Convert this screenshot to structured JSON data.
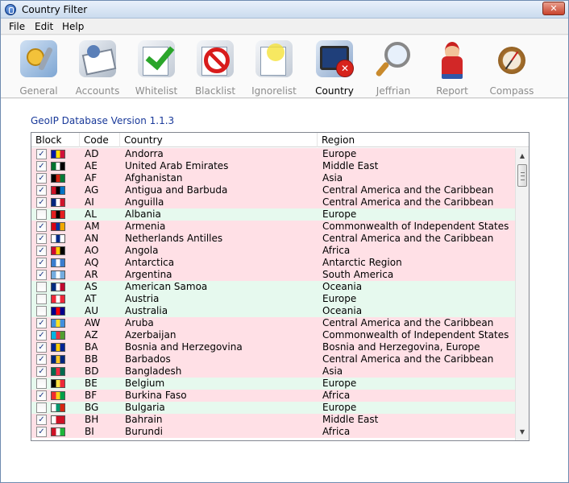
{
  "window": {
    "title": "Country Filter",
    "close_glyph": "✕"
  },
  "menu": [
    {
      "label": "File"
    },
    {
      "label": "Edit"
    },
    {
      "label": "Help"
    }
  ],
  "toolbar": [
    {
      "label": "General",
      "icon": "gear-key-icon",
      "active": false
    },
    {
      "label": "Accounts",
      "icon": "accounts-icon",
      "active": false
    },
    {
      "label": "Whitelist",
      "icon": "whitelist-check-icon",
      "active": false
    },
    {
      "label": "Blacklist",
      "icon": "blacklist-forbidden-icon",
      "active": false
    },
    {
      "label": "Ignorelist",
      "icon": "ignorelist-icon",
      "active": false
    },
    {
      "label": "Country",
      "icon": "country-block-icon",
      "active": true
    },
    {
      "label": "Jeffrian",
      "icon": "magnifier-icon",
      "active": false
    },
    {
      "label": "Report",
      "icon": "report-agent-icon",
      "active": false
    },
    {
      "label": "Compass",
      "icon": "compass-icon",
      "active": false
    }
  ],
  "geoip": {
    "version_label": "GeoIP Database Version 1.1.3"
  },
  "table": {
    "columns": [
      "Block",
      "Code",
      "Country",
      "Region"
    ],
    "colors": {
      "blocked_row": "#ffe0e6",
      "allowed_row": "#e6f9ee",
      "checkmark": "#1f3a8a"
    },
    "rows": [
      {
        "block": true,
        "code": "AD",
        "country": "Andorra",
        "region": "Europe",
        "flag": [
          "#0018a8",
          "#fedf00",
          "#d0103a"
        ]
      },
      {
        "block": true,
        "code": "AE",
        "country": "United Arab Emirates",
        "region": "Middle East",
        "flag": [
          "#00732f",
          "#ffffff",
          "#000000"
        ]
      },
      {
        "block": true,
        "code": "AF",
        "country": "Afghanistan",
        "region": "Asia",
        "flag": [
          "#000000",
          "#d32011",
          "#007a36"
        ]
      },
      {
        "block": true,
        "code": "AG",
        "country": "Antigua and Barbuda",
        "region": "Central America and the Caribbean",
        "flag": [
          "#ce1126",
          "#000000",
          "#0072c6"
        ]
      },
      {
        "block": true,
        "code": "AI",
        "country": "Anguilla",
        "region": "Central America and the Caribbean",
        "flag": [
          "#00247d",
          "#ffffff",
          "#cf142b"
        ]
      },
      {
        "block": false,
        "code": "AL",
        "country": "Albania",
        "region": "Europe",
        "flag": [
          "#e41e20",
          "#000000",
          "#e41e20"
        ]
      },
      {
        "block": true,
        "code": "AM",
        "country": "Armenia",
        "region": "Commonwealth of Independent States",
        "flag": [
          "#d90012",
          "#0033a0",
          "#f2a800"
        ]
      },
      {
        "block": true,
        "code": "AN",
        "country": "Netherlands Antilles",
        "region": "Central America and the Caribbean",
        "flag": [
          "#ffffff",
          "#012a87",
          "#ffffff"
        ]
      },
      {
        "block": true,
        "code": "AO",
        "country": "Angola",
        "region": "Africa",
        "flag": [
          "#cc092f",
          "#ffcb00",
          "#000000"
        ]
      },
      {
        "block": true,
        "code": "AQ",
        "country": "Antarctica",
        "region": "Antarctic Region",
        "flag": [
          "#3a7dce",
          "#ffffff",
          "#3a7dce"
        ]
      },
      {
        "block": true,
        "code": "AR",
        "country": "Argentina",
        "region": "South America",
        "flag": [
          "#74acdf",
          "#ffffff",
          "#74acdf"
        ]
      },
      {
        "block": false,
        "code": "AS",
        "country": "American Samoa",
        "region": "Oceania",
        "flag": [
          "#002b7f",
          "#ffffff",
          "#bf0a30"
        ]
      },
      {
        "block": false,
        "code": "AT",
        "country": "Austria",
        "region": "Europe",
        "flag": [
          "#ed2939",
          "#ffffff",
          "#ed2939"
        ]
      },
      {
        "block": false,
        "code": "AU",
        "country": "Australia",
        "region": "Oceania",
        "flag": [
          "#00008b",
          "#ff0000",
          "#00008b"
        ]
      },
      {
        "block": true,
        "code": "AW",
        "country": "Aruba",
        "region": "Central America and the Caribbean",
        "flag": [
          "#418fde",
          "#fbe122",
          "#418fde"
        ]
      },
      {
        "block": true,
        "code": "AZ",
        "country": "Azerbaijan",
        "region": "Commonwealth of Independent States",
        "flag": [
          "#00b5e2",
          "#ef3340",
          "#509e2f"
        ]
      },
      {
        "block": true,
        "code": "BA",
        "country": "Bosnia and Herzegovina",
        "region": "Bosnia and Herzegovina, Europe",
        "flag": [
          "#002395",
          "#fecb00",
          "#002395"
        ]
      },
      {
        "block": true,
        "code": "BB",
        "country": "Barbados",
        "region": "Central America and the Caribbean",
        "flag": [
          "#00267f",
          "#ffc726",
          "#00267f"
        ]
      },
      {
        "block": true,
        "code": "BD",
        "country": "Bangladesh",
        "region": "Asia",
        "flag": [
          "#006a4e",
          "#f42a41",
          "#006a4e"
        ]
      },
      {
        "block": false,
        "code": "BE",
        "country": "Belgium",
        "region": "Europe",
        "flag": [
          "#000000",
          "#fae042",
          "#ed2939"
        ]
      },
      {
        "block": true,
        "code": "BF",
        "country": "Burkina Faso",
        "region": "Africa",
        "flag": [
          "#ef2b2d",
          "#fcd116",
          "#009e49"
        ]
      },
      {
        "block": false,
        "code": "BG",
        "country": "Bulgaria",
        "region": "Europe",
        "flag": [
          "#ffffff",
          "#00966e",
          "#d62612"
        ]
      },
      {
        "block": true,
        "code": "BH",
        "country": "Bahrain",
        "region": "Middle East",
        "flag": [
          "#ffffff",
          "#ce1126",
          "#ce1126"
        ]
      },
      {
        "block": true,
        "code": "BI",
        "country": "Burundi",
        "region": "Africa",
        "flag": [
          "#ce1126",
          "#ffffff",
          "#1eb53a"
        ]
      }
    ]
  }
}
